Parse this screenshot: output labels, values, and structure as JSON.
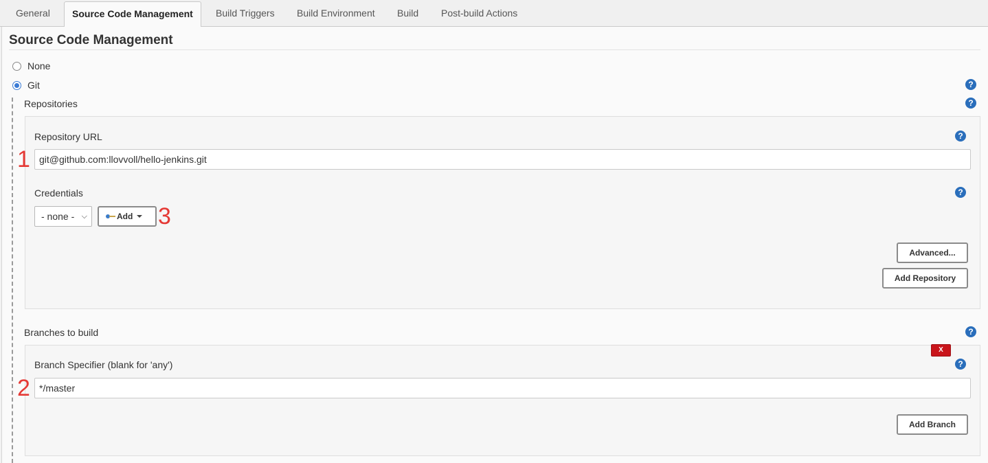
{
  "tabs": [
    {
      "label": "General"
    },
    {
      "label": "Source Code Management"
    },
    {
      "label": "Build Triggers"
    },
    {
      "label": "Build Environment"
    },
    {
      "label": "Build"
    },
    {
      "label": "Post-build Actions"
    }
  ],
  "section": {
    "title": "Source Code Management"
  },
  "scm_options": [
    {
      "label": "None",
      "selected": false
    },
    {
      "label": "Git",
      "selected": true
    }
  ],
  "repositories": {
    "label": "Repositories",
    "url_label": "Repository URL",
    "url_value": "git@github.com:llovvoll/hello-jenkins.git",
    "credentials_label": "Credentials",
    "credentials_value": "- none -",
    "add_label": "Add",
    "advanced_label": "Advanced...",
    "add_repository_label": "Add Repository"
  },
  "branches": {
    "label": "Branches to build",
    "specifier_label": "Branch Specifier (blank for 'any')",
    "specifier_value": "*/master",
    "delete_label": "X",
    "add_branch_label": "Add Branch"
  },
  "help_glyph": "?",
  "annotations": [
    "1",
    "2",
    "3"
  ],
  "colors": {
    "help": "#2a6ebb",
    "annotation": "#e53935",
    "delete": "#c9151b"
  }
}
